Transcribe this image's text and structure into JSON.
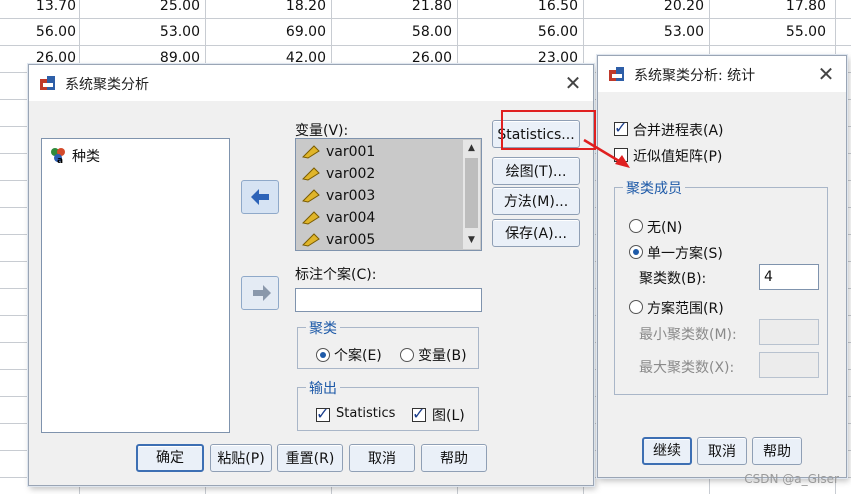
{
  "sheet": {
    "rows": [
      [
        "13.70",
        "25.00",
        "18.20",
        "21.80",
        "16.50",
        "20.20",
        "17.80"
      ],
      [
        "56.00",
        "53.00",
        "69.00",
        "58.00",
        "56.00",
        "53.00",
        "55.00"
      ],
      [
        "26.00",
        "89.00",
        "42.00",
        "26.00",
        "23.00",
        "",
        ""
      ]
    ]
  },
  "main_dialog": {
    "title": "系统聚类分析",
    "source_var": "种类",
    "variables_label": "变量(V):",
    "variables": [
      "var001",
      "var002",
      "var003",
      "var004",
      "var005"
    ],
    "label_cases_label": "标注个案(C):",
    "label_cases_value": "",
    "cluster_group": {
      "title": "聚类",
      "options": [
        "个案(E)",
        "变量(B)"
      ],
      "selected": "个案(E)"
    },
    "output_group": {
      "title": "输出",
      "statistics": "Statistics",
      "plots": "图(L)"
    },
    "side_buttons": [
      "Statistics...",
      "绘图(T)...",
      "方法(M)...",
      "保存(A)..."
    ],
    "bottom_buttons": [
      "确定",
      "粘贴(P)",
      "重置(R)",
      "取消",
      "帮助"
    ]
  },
  "stats_dialog": {
    "title": "系统聚类分析: 统计",
    "agglomeration_schedule": "合并进程表(A)",
    "proximity_matrix": "近似值矩阵(P)",
    "membership_group": {
      "title": "聚类成员",
      "none": "无(N)",
      "single": "单一方案(S)",
      "clusters_label": "聚类数(B):",
      "clusters_value": "4",
      "range": "方案范围(R)",
      "min_label": "最小聚类数(M):",
      "max_label": "最大聚类数(X):"
    },
    "buttons": [
      "继续",
      "取消",
      "帮助"
    ]
  },
  "watermark": "CSDN @a_GIser",
  "colors": {
    "annotation": "#e02020",
    "group_title": "#1e5aa8",
    "arrow_button": "#2d63b8"
  }
}
